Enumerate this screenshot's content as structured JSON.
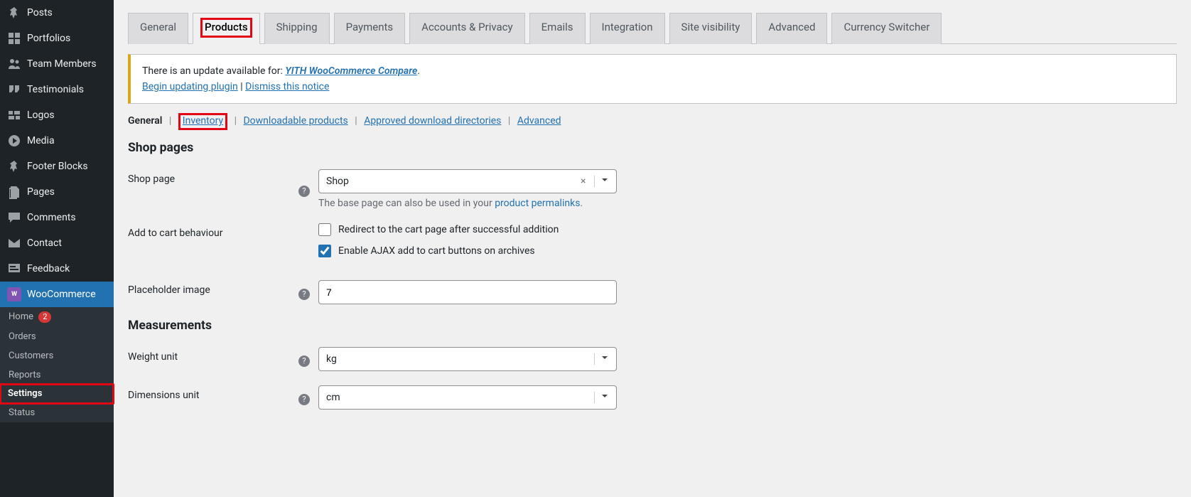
{
  "sidebar": {
    "items": [
      {
        "icon": "pin",
        "label": "Posts"
      },
      {
        "icon": "grid",
        "label": "Portfolios"
      },
      {
        "icon": "users",
        "label": "Team Members"
      },
      {
        "icon": "quote",
        "label": "Testimonials"
      },
      {
        "icon": "squares",
        "label": "Logos"
      },
      {
        "icon": "media",
        "label": "Media"
      },
      {
        "icon": "pin",
        "label": "Footer Blocks"
      },
      {
        "icon": "pages",
        "label": "Pages"
      },
      {
        "icon": "comment",
        "label": "Comments"
      },
      {
        "icon": "mail",
        "label": "Contact"
      },
      {
        "icon": "feedback",
        "label": "Feedback"
      },
      {
        "icon": "woo",
        "label": "WooCommerce"
      }
    ],
    "submenu": [
      {
        "label": "Home",
        "badge": "2"
      },
      {
        "label": "Orders"
      },
      {
        "label": "Customers"
      },
      {
        "label": "Reports"
      },
      {
        "label": "Settings"
      },
      {
        "label": "Status"
      }
    ]
  },
  "tabs": [
    "General",
    "Products",
    "Shipping",
    "Payments",
    "Accounts & Privacy",
    "Emails",
    "Integration",
    "Site visibility",
    "Advanced",
    "Currency Switcher"
  ],
  "notice": {
    "pre": "There is an update available for: ",
    "plugin": "YITH WooCommerce Compare",
    "dot": ".",
    "begin": "Begin updating plugin",
    "sep": " | ",
    "dismiss": "Dismiss this notice"
  },
  "subnav": [
    "General",
    "Inventory",
    "Downloadable products",
    "Approved download directories",
    "Advanced"
  ],
  "sections": {
    "shop_pages": "Shop pages",
    "measurements": "Measurements"
  },
  "fields": {
    "shop_page": {
      "label": "Shop page",
      "value": "Shop",
      "desc_pre": "The base page can also be used in your ",
      "desc_link": "product permalinks",
      "desc_post": "."
    },
    "add_to_cart": {
      "label": "Add to cart behaviour",
      "redirect": "Redirect to the cart page after successful addition",
      "ajax": "Enable AJAX add to cart buttons on archives"
    },
    "placeholder_image": {
      "label": "Placeholder image",
      "value": "7"
    },
    "weight_unit": {
      "label": "Weight unit",
      "value": "kg"
    },
    "dimensions_unit": {
      "label": "Dimensions unit",
      "value": "cm"
    }
  }
}
